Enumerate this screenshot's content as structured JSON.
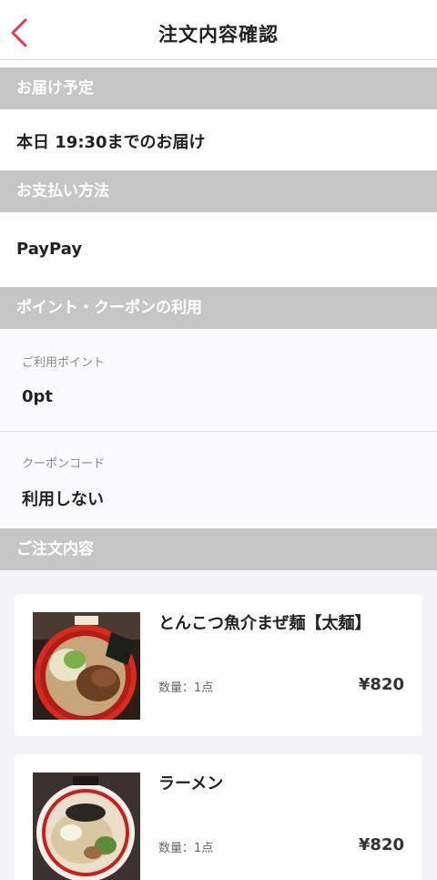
{
  "header": {
    "title": "注文内容確認",
    "back_icon": "chevron-left-icon",
    "accent": "#e53946"
  },
  "delivery": {
    "section": "お届け予定",
    "value": "本日 19:30までのお届け"
  },
  "payment": {
    "section": "お支払い方法",
    "value": "PayPay"
  },
  "points": {
    "section": "ポイント・クーポンの利用",
    "points_label": "ご利用ポイント",
    "points_value": "0pt",
    "coupon_label": "クーポンコード",
    "coupon_value": "利用しない"
  },
  "order": {
    "section": "ご注文内容",
    "items": [
      {
        "name": "とんこつ魚介まぜ麺【太麺】",
        "qty": "数量：1点",
        "price": "¥820"
      },
      {
        "name": "ラーメン",
        "qty": "数量：1点",
        "price": "¥820"
      }
    ]
  }
}
